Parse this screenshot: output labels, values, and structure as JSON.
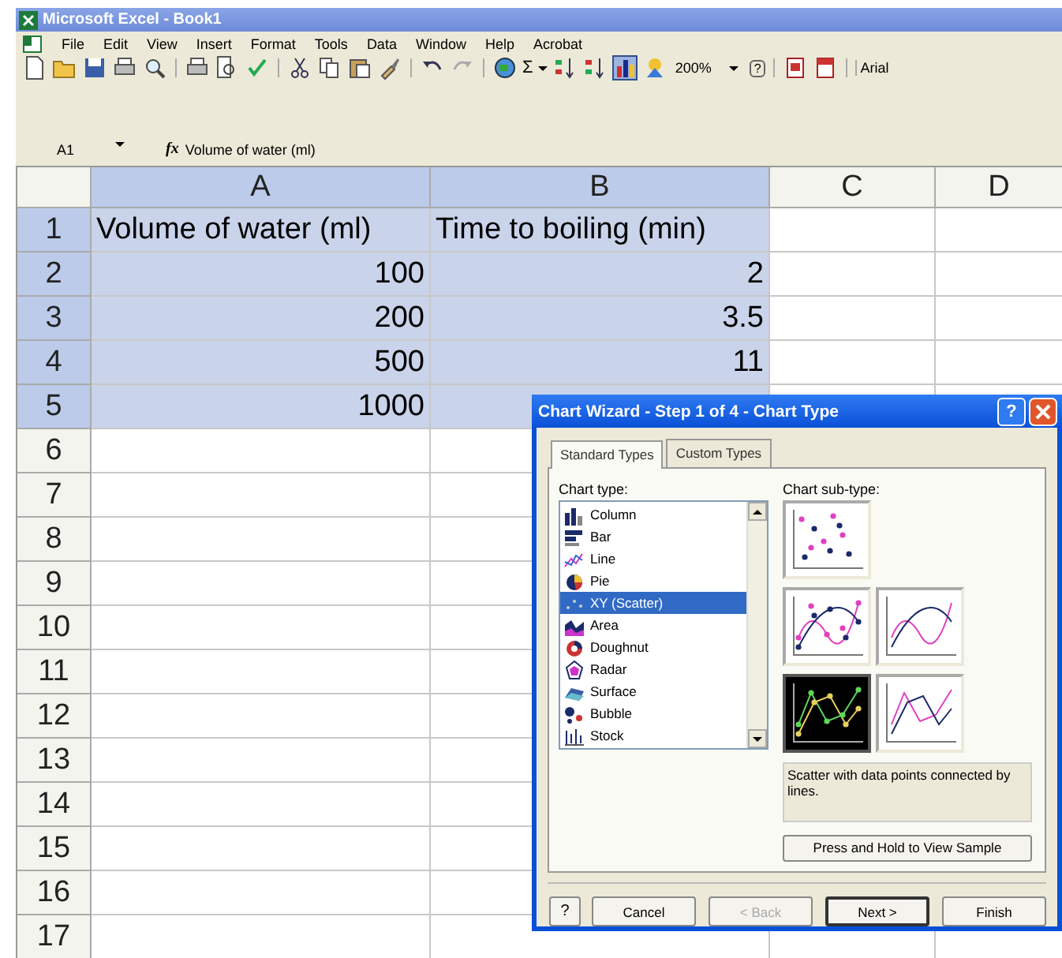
{
  "window": {
    "title": "Microsoft Excel - Book1"
  },
  "menu": [
    "File",
    "Edit",
    "View",
    "Insert",
    "Format",
    "Tools",
    "Data",
    "Window",
    "Help",
    "Acrobat"
  ],
  "toolbar": {
    "autosum": "Σ",
    "chart_wizard_pressed": true,
    "zoom": "200%",
    "help": "?",
    "font": "Arial"
  },
  "formula_bar": {
    "name_box": "A1",
    "fx": "fx",
    "value": "Volume of water (ml)"
  },
  "sheet": {
    "columns": [
      {
        "label": "A",
        "selected": true
      },
      {
        "label": "B",
        "selected": true
      },
      {
        "label": "C",
        "selected": false
      },
      {
        "label": "D",
        "selected": false
      }
    ],
    "rows": [
      {
        "label": "1",
        "selected": true,
        "cells": [
          {
            "text": "Volume of water (ml)",
            "kind": "text"
          },
          {
            "text": "Time to boiling (min)",
            "kind": "text"
          }
        ]
      },
      {
        "label": "2",
        "selected": true,
        "cells": [
          {
            "text": "100",
            "kind": "number"
          },
          {
            "text": "2",
            "kind": "number"
          }
        ]
      },
      {
        "label": "3",
        "selected": true,
        "cells": [
          {
            "text": "200",
            "kind": "number"
          },
          {
            "text": "3.5",
            "kind": "number"
          }
        ]
      },
      {
        "label": "4",
        "selected": true,
        "cells": [
          {
            "text": "500",
            "kind": "number"
          },
          {
            "text": "11",
            "kind": "number"
          }
        ]
      },
      {
        "label": "5",
        "selected": true,
        "cells": [
          {
            "text": "1000",
            "kind": "number"
          }
        ]
      },
      {
        "label": "6",
        "selected": false
      },
      {
        "label": "7",
        "selected": false
      },
      {
        "label": "8",
        "selected": false
      },
      {
        "label": "9",
        "selected": false
      },
      {
        "label": "10",
        "selected": false
      },
      {
        "label": "11",
        "selected": false
      },
      {
        "label": "12",
        "selected": false
      },
      {
        "label": "13",
        "selected": false
      },
      {
        "label": "14",
        "selected": false
      },
      {
        "label": "15",
        "selected": false
      },
      {
        "label": "16",
        "selected": false
      },
      {
        "label": "17",
        "selected": false
      }
    ]
  },
  "dialog": {
    "title": "Chart Wizard - Step 1 of 4 - Chart Type",
    "help": "?",
    "tabs": [
      {
        "label": "Standard Types",
        "selected": true
      },
      {
        "label": "Custom Types",
        "selected": false
      }
    ],
    "chart_type_label": "Chart type:",
    "chart_types": [
      {
        "label": "Column",
        "selected": false
      },
      {
        "label": "Bar",
        "selected": false
      },
      {
        "label": "Line",
        "selected": false
      },
      {
        "label": "Pie",
        "selected": false
      },
      {
        "label": "XY (Scatter)",
        "selected": true
      },
      {
        "label": "Area",
        "selected": false
      },
      {
        "label": "Doughnut",
        "selected": false
      },
      {
        "label": "Radar",
        "selected": false
      },
      {
        "label": "Surface",
        "selected": false
      },
      {
        "label": "Bubble",
        "selected": false
      },
      {
        "label": "Stock",
        "selected": false
      }
    ],
    "subtype_label": "Chart sub-type:",
    "subtypes": [
      {
        "kind": "markers",
        "selected": false
      },
      {
        "kind": "smooth-markers",
        "selected": false
      },
      {
        "kind": "smooth",
        "selected": false
      },
      {
        "kind": "lines-markers",
        "selected": true
      },
      {
        "kind": "lines",
        "selected": false
      }
    ],
    "description": "Scatter with data points connected by lines.",
    "sample_button": "Press and Hold to View Sample",
    "help_button": "?",
    "buttons": [
      {
        "label": "Cancel",
        "disabled": false,
        "default": false
      },
      {
        "label": "< Back",
        "disabled": true,
        "default": false
      },
      {
        "label": "Next >",
        "disabled": false,
        "default": true
      },
      {
        "label": "Finish",
        "disabled": false,
        "default": false
      }
    ]
  }
}
